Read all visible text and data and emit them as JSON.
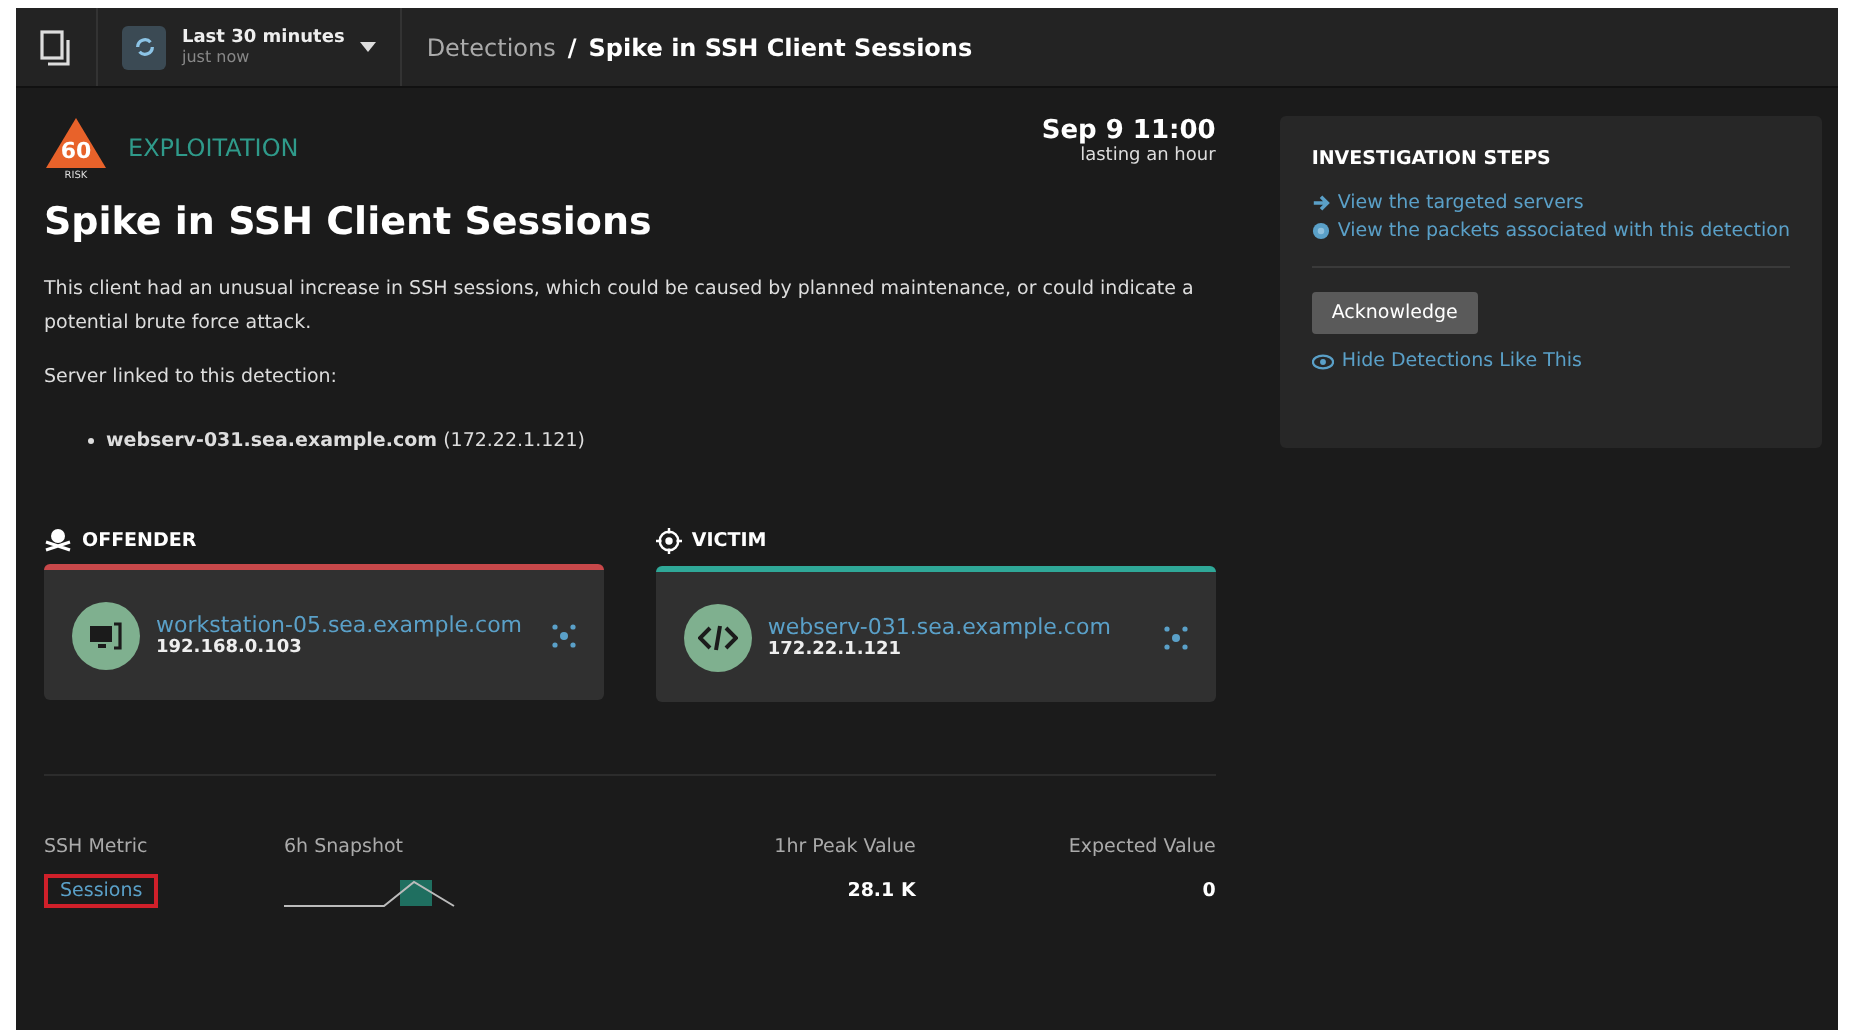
{
  "topbar": {
    "time_range": "Last 30 minutes",
    "time_updated": "just now",
    "breadcrumb": [
      {
        "label": "Detections",
        "current": false
      },
      {
        "label": "Spike in SSH Client Sessions",
        "current": true
      }
    ],
    "separator": "/"
  },
  "detection": {
    "risk": "60",
    "risk_label": "RISK",
    "category": "EXPLOITATION",
    "date": "Sep 9 11:00",
    "duration": "lasting an hour",
    "title": "Spike in SSH Client Sessions",
    "description": "This client had an unusual increase in SSH sessions, which could be caused by planned maintenance, or could indicate a potential brute force attack.",
    "linked_heading": "Server linked to this detection:",
    "linked": [
      {
        "name": "webserv-031.sea.example.com",
        "ip": "(172.22.1.121)"
      }
    ]
  },
  "participants": [
    {
      "kind": "offender",
      "role": "OFFENDER",
      "device": "workstation-05.sea.example.com",
      "ip": "192.168.0.103"
    },
    {
      "kind": "victim",
      "role": "VICTIM",
      "device": "webserv-031.sea.example.com",
      "ip": "172.22.1.121"
    }
  ],
  "metrics": {
    "columns": [
      "SSH Metric",
      "6h Snapshot",
      "1hr Peak Value",
      "Expected Value"
    ],
    "rows": [
      {
        "metric": "Sessions",
        "highlighted": true,
        "peak": "28.1 K",
        "expected": "0"
      }
    ]
  },
  "investigation": {
    "title": "INVESTIGATION STEPS",
    "steps": [
      {
        "kind": "arrow",
        "label": "View the targeted servers"
      },
      {
        "kind": "packets",
        "label": "View the packets associated with this detection"
      }
    ],
    "button": "Acknowledge",
    "hide_link": "Hide Detections Like This"
  }
}
